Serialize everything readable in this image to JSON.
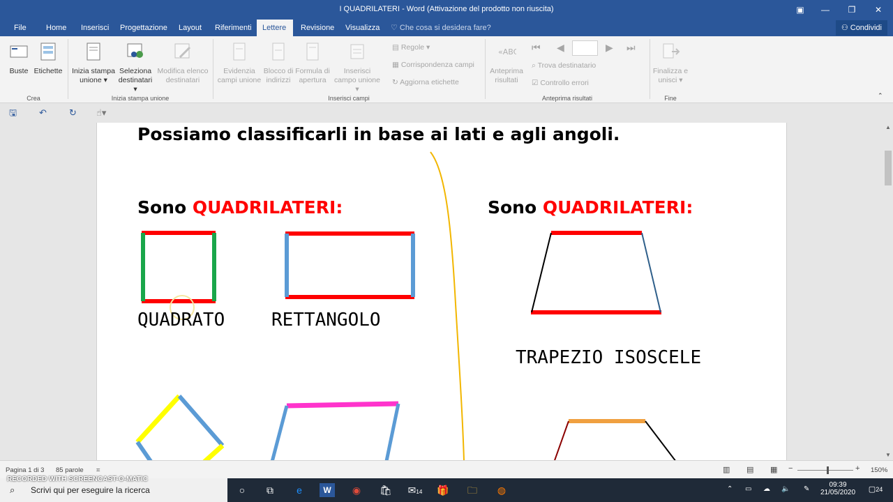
{
  "window": {
    "title": "I QUADRILATERI - Word (Attivazione del prodotto non riuscita)"
  },
  "tabs": [
    {
      "label": "File"
    },
    {
      "label": "Home"
    },
    {
      "label": "Inserisci"
    },
    {
      "label": "Progettazione"
    },
    {
      "label": "Layout"
    },
    {
      "label": "Riferimenti"
    },
    {
      "label": "Lettere"
    },
    {
      "label": "Revisione"
    },
    {
      "label": "Visualizza"
    }
  ],
  "tellme": "Che cosa si desidera fare?",
  "share": "Condividi",
  "ribbon": {
    "buste": "Buste",
    "etichette": "Etichette",
    "crea": "Crea",
    "inizia_stampa": "Inizia stampa unione ▾",
    "seleziona_dest": "Seleziona destinatari ▾",
    "modifica_elenco": "Modifica elenco destinatari",
    "group_inizia": "Inizia stampa unione",
    "evidenzia": "Evidenzia campi unione",
    "blocco": "Blocco di indirizzi",
    "formula": "Formula di apertura",
    "inserisci_campo": "Inserisci campo unione ▾",
    "regole": "Regole ▾",
    "corrispondenza": "Corrispondenza campi",
    "aggiorna": "Aggiorna etichette",
    "group_inserisci": "Inserisci campi",
    "anteprima": "Anteprima risultati",
    "trova": "Trova destinatario",
    "controllo": "Controllo errori",
    "group_anteprima": "Anteprima risultati",
    "finalizza": "Finalizza e unisci ▾",
    "group_fine": "Fine"
  },
  "document": {
    "heading": "Possiamo classificarli in base ai lati e agli angoli.",
    "left_label_prefix": "Sono ",
    "left_label_highlight": "QUADRILATERI:",
    "right_label_prefix": "Sono ",
    "right_label_highlight": "QUADRILATERI:",
    "quadrato": "QUADRATO",
    "rettangolo": "RETTANGOLO",
    "trapezio": "TRAPEZIO ISOSCELE"
  },
  "status": {
    "page": "Pagina 1 di 3",
    "words": "85 parole",
    "zoom": "150%"
  },
  "taskbar": {
    "search": "Scrivi qui per eseguire la ricerca",
    "time": "09:39",
    "date": "21/05/2020",
    "mail_badge": "14",
    "notifications": "24"
  },
  "watermark": "RECORDED WITH SCREENCAST-O-MATIC"
}
